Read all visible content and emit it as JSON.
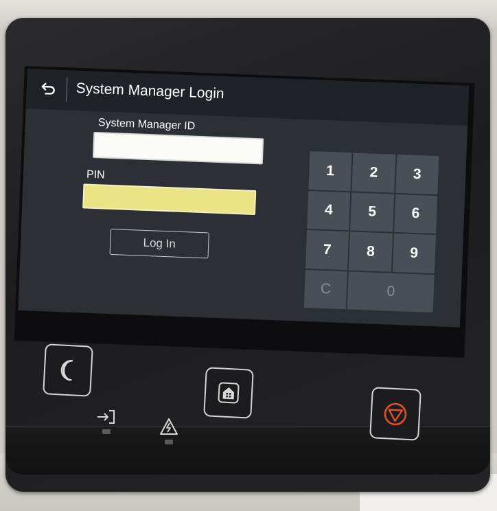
{
  "screen": {
    "title": "System Manager Login",
    "id_field": {
      "label": "System Manager ID",
      "value": ""
    },
    "pin_field": {
      "label": "PIN",
      "value": ""
    },
    "login_label": "Log In",
    "keypad": {
      "keys": [
        "1",
        "2",
        "3",
        "4",
        "5",
        "6",
        "7",
        "8",
        "9",
        "C",
        "0"
      ],
      "clear_label": "C",
      "zero_label": "0"
    },
    "icons": {
      "back": "back-arrow-icon"
    }
  },
  "hardware": {
    "buttons": [
      {
        "name": "energy-saver",
        "icon": "moon-icon"
      },
      {
        "name": "home",
        "icon": "home-icon"
      },
      {
        "name": "stop",
        "icon": "stop-icon",
        "color": "#e0502a"
      }
    ],
    "indicators": [
      {
        "name": "processing-data",
        "icon": "data-arrow-icon"
      },
      {
        "name": "error",
        "icon": "warning-icon"
      }
    ]
  },
  "colors": {
    "pin_field": "#ebe487",
    "id_field": "#fbfbf7",
    "screen_bg": "#2c2f36",
    "key_bg": "#4a4e57",
    "stop_accent": "#e0502a"
  }
}
